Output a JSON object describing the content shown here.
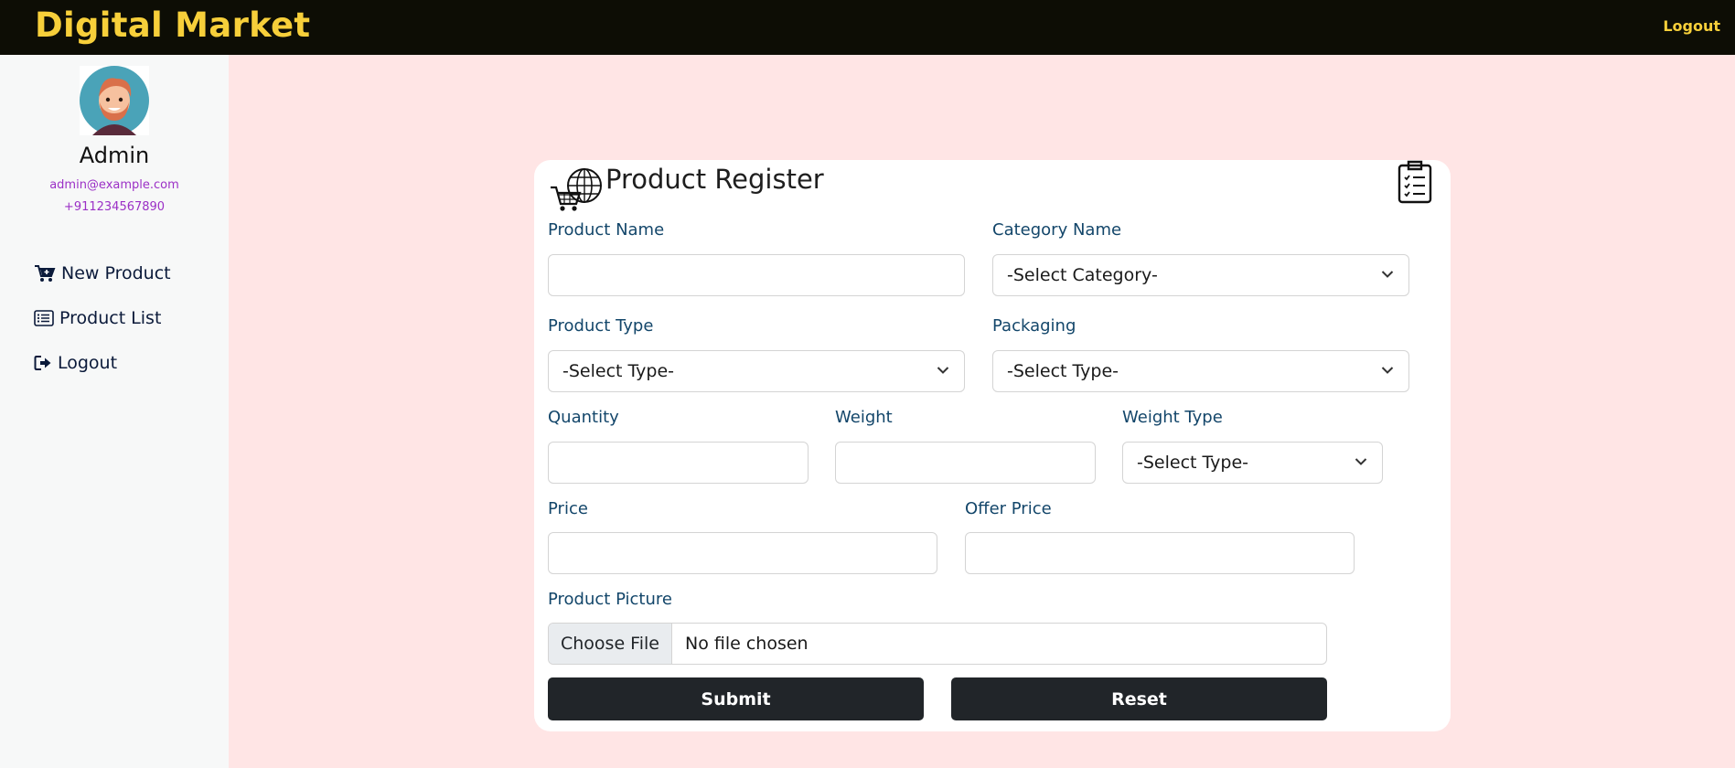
{
  "header": {
    "brand": "Digital Market",
    "logout_label": "Logout"
  },
  "sidebar": {
    "user_name": "Admin",
    "user_email": "admin@example.com",
    "user_phone": "+911234567890",
    "items": [
      {
        "label": "New Product",
        "icon": "cart-plus-icon"
      },
      {
        "label": "Product List",
        "icon": "list-icon"
      },
      {
        "label": "Logout",
        "icon": "sign-out-icon"
      }
    ]
  },
  "form": {
    "title": "Product Register",
    "product_name_label": "Product Name",
    "category_label": "Category Name",
    "category_value": "-Select Category-",
    "product_type_label": "Product Type",
    "product_type_value": "-Select Type-",
    "packaging_label": "Packaging",
    "packaging_value": "-Select Type-",
    "quantity_label": "Quantity",
    "weight_label": "Weight",
    "weight_type_label": "Weight Type",
    "weight_type_value": "-Select Type-",
    "price_label": "Price",
    "offer_price_label": "Offer Price",
    "picture_label": "Product Picture",
    "file_button": "Choose File",
    "file_status": "No file chosen",
    "submit_label": "Submit",
    "reset_label": "Reset"
  },
  "colors": {
    "brand": "#f7cf3a",
    "page_bg": "#ffe5e5",
    "button": "#212529"
  }
}
